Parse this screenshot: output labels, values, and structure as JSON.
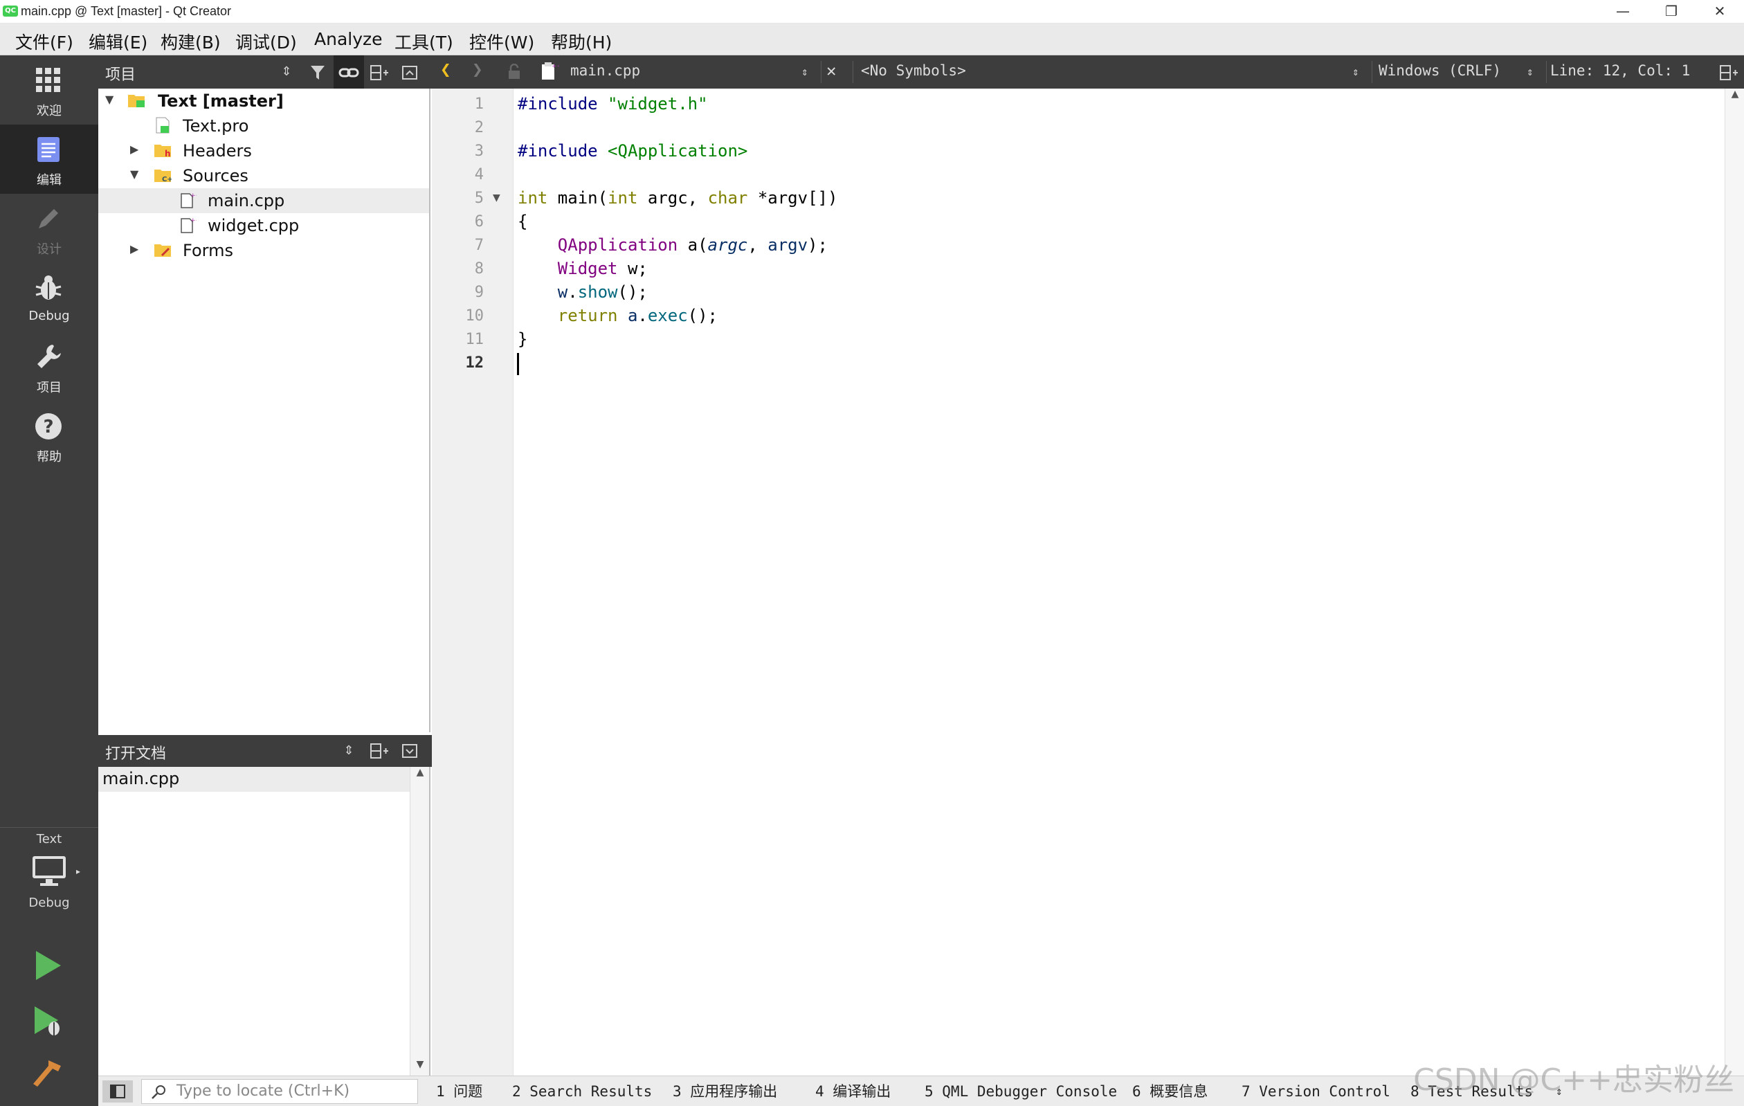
{
  "window": {
    "title": "main.cpp @ Text [master] - Qt Creator",
    "app_icon": "qt-icon",
    "minimize": "—",
    "restore": "❐",
    "close": "✕"
  },
  "menu": [
    "文件(F)",
    "编辑(E)",
    "构建(B)",
    "调试(D)",
    "Analyze",
    "工具(T)",
    "控件(W)",
    "帮助(H)"
  ],
  "modes": [
    {
      "label": "欢迎",
      "icon": "grid-icon"
    },
    {
      "label": "编辑",
      "icon": "edit-document-icon"
    },
    {
      "label": "设计",
      "icon": "pencil-icon"
    },
    {
      "label": "Debug",
      "icon": "bug-icon"
    },
    {
      "label": "项目",
      "icon": "wrench-icon"
    },
    {
      "label": "帮助",
      "icon": "help-icon"
    }
  ],
  "target": {
    "project": "Text",
    "config": "Debug"
  },
  "project_pane": {
    "title": "项目",
    "tree": [
      {
        "label": "Text [master]",
        "level": 0,
        "expanded": true,
        "bold": true,
        "icon": "qt-project-folder-icon"
      },
      {
        "label": "Text.pro",
        "level": 1,
        "icon": "pro-file-icon"
      },
      {
        "label": "Headers",
        "level": 1,
        "expanded": false,
        "icon": "headers-folder-icon"
      },
      {
        "label": "Sources",
        "level": 1,
        "expanded": true,
        "icon": "sources-folder-icon"
      },
      {
        "label": "main.cpp",
        "level": 2,
        "selected": true,
        "icon": "cpp-file-icon"
      },
      {
        "label": "widget.cpp",
        "level": 2,
        "icon": "cpp-file-icon"
      },
      {
        "label": "Forms",
        "level": 1,
        "expanded": false,
        "icon": "forms-folder-icon"
      }
    ]
  },
  "open_docs": {
    "title": "打开文档",
    "items": [
      "main.cpp"
    ]
  },
  "editor_toolbar": {
    "file": "main.cpp",
    "symbols": "<No Symbols>",
    "line_ending": "Windows (CRLF)",
    "position": "Line: 12, Col: 1"
  },
  "editor": {
    "line_numbers": [
      "1",
      "2",
      "3",
      "4",
      "5",
      "6",
      "7",
      "8",
      "9",
      "10",
      "11",
      "12"
    ],
    "current_line": 12
  },
  "locator": {
    "placeholder": "Type to locate (Ctrl+K)"
  },
  "output_panes": [
    "1  问题",
    "2  Search Results",
    "3  应用程序输出",
    "4  编译输出",
    "5  QML Debugger Console",
    "6  概要信息",
    "7  Version Control",
    "8  Test Results"
  ],
  "watermark": "CSDN @C++忠实粉丝",
  "colors": {
    "preprocessor": "#000080",
    "string": "#008000",
    "type_keyword": "#808000",
    "class": "#800080",
    "member": "#00677c",
    "param": "#092e64"
  }
}
